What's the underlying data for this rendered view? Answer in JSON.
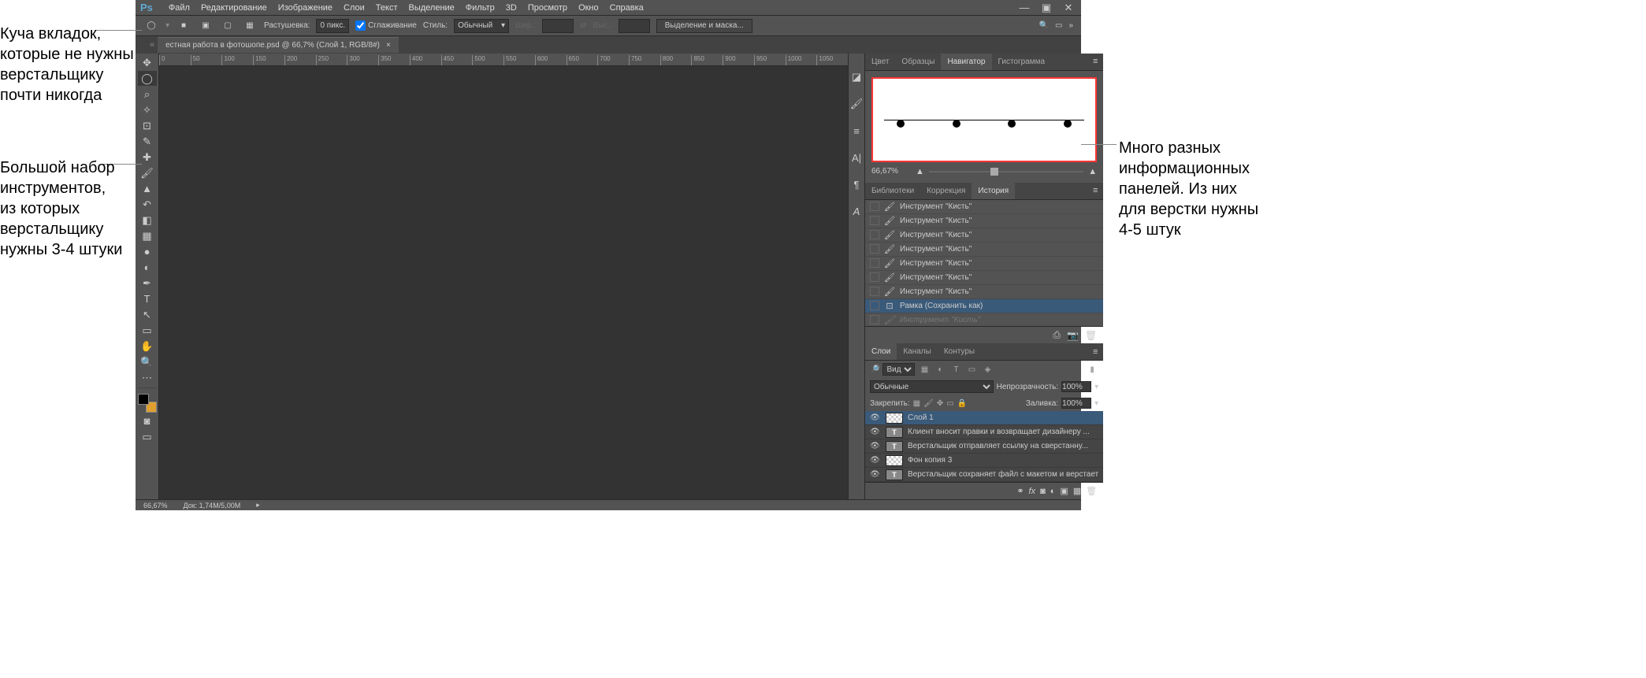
{
  "annotations": {
    "top_left": "Куча вкладок,\nкоторые не нужны\nверстальщику\nпочти никогда",
    "mid_left": "Большой набор\nинструментов,\nиз которых\nверстальщику\nнужны 3-4 штуки",
    "right": "Много разных\nинформационных\nпанелей. Из них\nдля верстки нужны\n4-5 штук"
  },
  "menu": [
    "Файл",
    "Редактирование",
    "Изображение",
    "Слои",
    "Текст",
    "Выделение",
    "Фильтр",
    "3D",
    "Просмотр",
    "Окно",
    "Справка"
  ],
  "options": {
    "feather_label": "Растушевка:",
    "feather_value": "0 пикс.",
    "smooth": "Сглаживание",
    "style_label": "Стиль:",
    "style_value": "Обычный",
    "width_label": "Шир.:",
    "height_label": "Выс.:",
    "refine": "Выделение и маска..."
  },
  "document": {
    "tab": "естная работа в фотошопе.psd @ 66,7% (Слой 1, RGB/8#)",
    "ruler_ticks": [
      "0",
      "50",
      "100",
      "150",
      "200",
      "250",
      "300",
      "350",
      "400",
      "450",
      "500",
      "550",
      "600",
      "650",
      "700",
      "750",
      "800",
      "850",
      "900",
      "950",
      "1000",
      "1050"
    ]
  },
  "navigator_panel": {
    "tabs": [
      "Цвет",
      "Образцы",
      "Навигатор",
      "Гистограмма"
    ],
    "active": 2,
    "zoom": "66,67%"
  },
  "history_panel": {
    "tabs": [
      "Библиотеки",
      "Коррекция",
      "История"
    ],
    "active": 2,
    "items": [
      {
        "icon": "brush",
        "label": "Инструмент \"Кисть\""
      },
      {
        "icon": "brush",
        "label": "Инструмент \"Кисть\""
      },
      {
        "icon": "brush",
        "label": "Инструмент \"Кисть\""
      },
      {
        "icon": "brush",
        "label": "Инструмент \"Кисть\""
      },
      {
        "icon": "brush",
        "label": "Инструмент \"Кисть\""
      },
      {
        "icon": "brush",
        "label": "Инструмент \"Кисть\""
      },
      {
        "icon": "brush",
        "label": "Инструмент \"Кисть\""
      },
      {
        "icon": "crop",
        "label": "Рамка (Сохранить как)",
        "selected": true
      },
      {
        "icon": "brush",
        "label": "Инструмент \"Кисть\"",
        "dimmed": true
      }
    ]
  },
  "layers_panel": {
    "tabs": [
      "Слои",
      "Каналы",
      "Контуры"
    ],
    "active": 0,
    "kind_label": "Вид",
    "blend_mode": "Обычные",
    "opacity_label": "Непрозрачность:",
    "opacity_value": "100%",
    "lock_label": "Закрепить:",
    "fill_label": "Заливка:",
    "fill_value": "100%",
    "layers": [
      {
        "type": "checker",
        "name": "Слой 1",
        "selected": true
      },
      {
        "type": "T",
        "name": "Клиент вносит  правки и возвращает  дизайнеру ..."
      },
      {
        "type": "T",
        "name": "Верстальщик  отправляет ссылку на сверстанну..."
      },
      {
        "type": "checker",
        "name": "Фон копия 3"
      },
      {
        "type": "T",
        "name": "Верстальщик  сохраняет файл с макетом и верстает"
      }
    ]
  },
  "status": {
    "zoom": "66,67%",
    "doc": "Док: 1,74M/5,00M"
  }
}
